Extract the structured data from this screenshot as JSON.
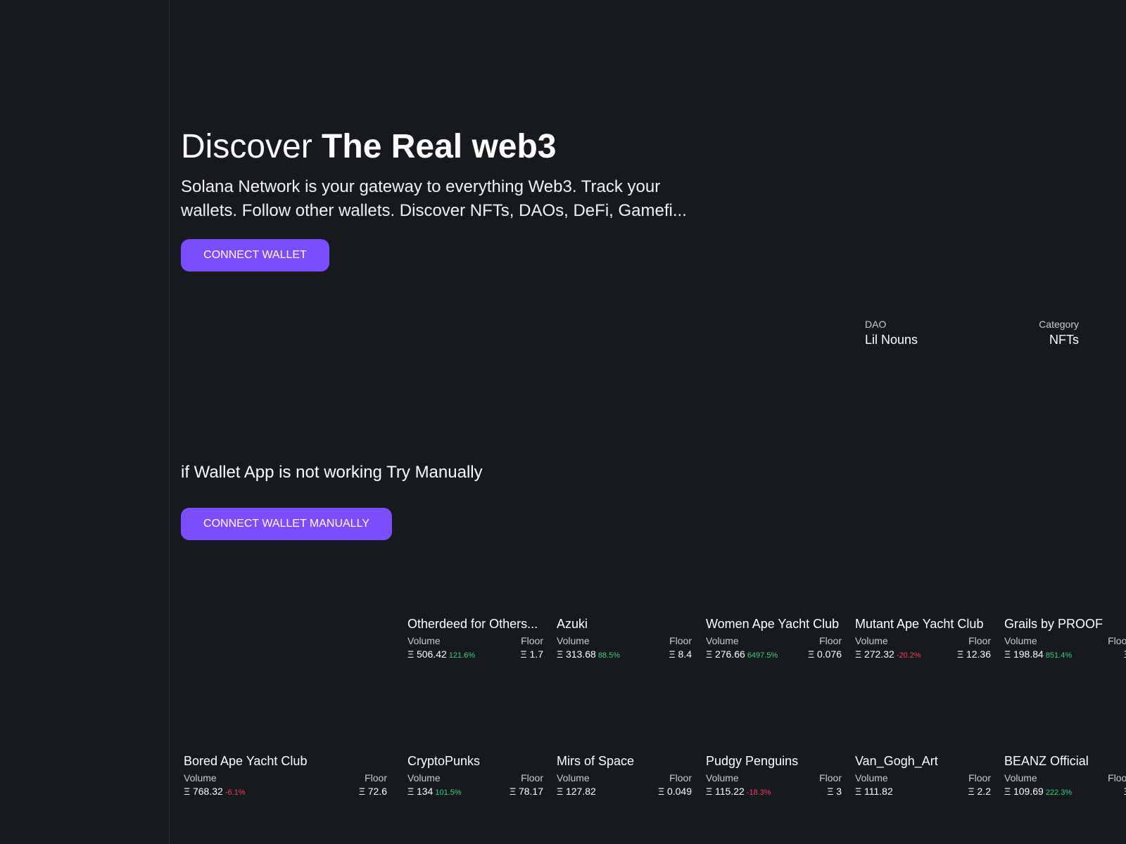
{
  "hero": {
    "title_plain": "Discover",
    "title_bold": "The Real web3",
    "subtitle": "Solana Network is your gateway to everything Web3. Track your wallets. Follow other wallets. Discover NFTs, DAOs, DeFi, Gamefi...",
    "connect_label": "CONNECT WALLET"
  },
  "featured": {
    "dao_label": "DAO",
    "dao_value": "Lil Nouns",
    "category_label": "Category",
    "category_value": "NFTs"
  },
  "manual": {
    "note": "if Wallet App is not working Try Manually",
    "button_label": "CONNECT WALLET MANUALLY"
  },
  "labels": {
    "volume": "Volume",
    "floor": "Floor"
  },
  "collections": [
    {
      "name": "Otherdeed for Others...",
      "volume": "Ξ 506.42",
      "change": "121.6%",
      "trend": "up",
      "floor": "Ξ 1.7"
    },
    {
      "name": "Azuki",
      "volume": "Ξ 313.68",
      "change": "88.5%",
      "trend": "up",
      "floor": "Ξ 8.4"
    },
    {
      "name": "Women Ape Yacht Club",
      "volume": "Ξ 276.66",
      "change": "6497.5%",
      "trend": "up",
      "floor": "Ξ 0.076"
    },
    {
      "name": "Mutant Ape Yacht Club",
      "volume": "Ξ 272.32",
      "change": "-20.2%",
      "trend": "down",
      "floor": "Ξ 12.36"
    },
    {
      "name": "Grails by PROOF",
      "volume": "Ξ 198.84",
      "change": "851.4%",
      "trend": "up",
      "floor": "Ξ"
    },
    {
      "name": "Bored Ape Yacht Club",
      "volume": "Ξ 768.32",
      "change": "-6.1%",
      "trend": "down",
      "floor": "Ξ 72.6"
    },
    {
      "name": "CryptoPunks",
      "volume": "Ξ 134",
      "change": "101.5%",
      "trend": "up",
      "floor": "Ξ 78.17"
    },
    {
      "name": "Mirs of Space",
      "volume": "Ξ 127.82",
      "change": "",
      "trend": "",
      "floor": "Ξ 0.049"
    },
    {
      "name": "Pudgy Penguins",
      "volume": "Ξ 115.22",
      "change": "-18.3%",
      "trend": "down",
      "floor": "Ξ 3"
    },
    {
      "name": "Van_Gogh_Art",
      "volume": "Ξ 111.82",
      "change": "",
      "trend": "",
      "floor": "Ξ 2.2"
    },
    {
      "name": "BEANZ Official",
      "volume": "Ξ 109.69",
      "change": "222.3%",
      "trend": "up",
      "floor": "Ξ"
    }
  ]
}
